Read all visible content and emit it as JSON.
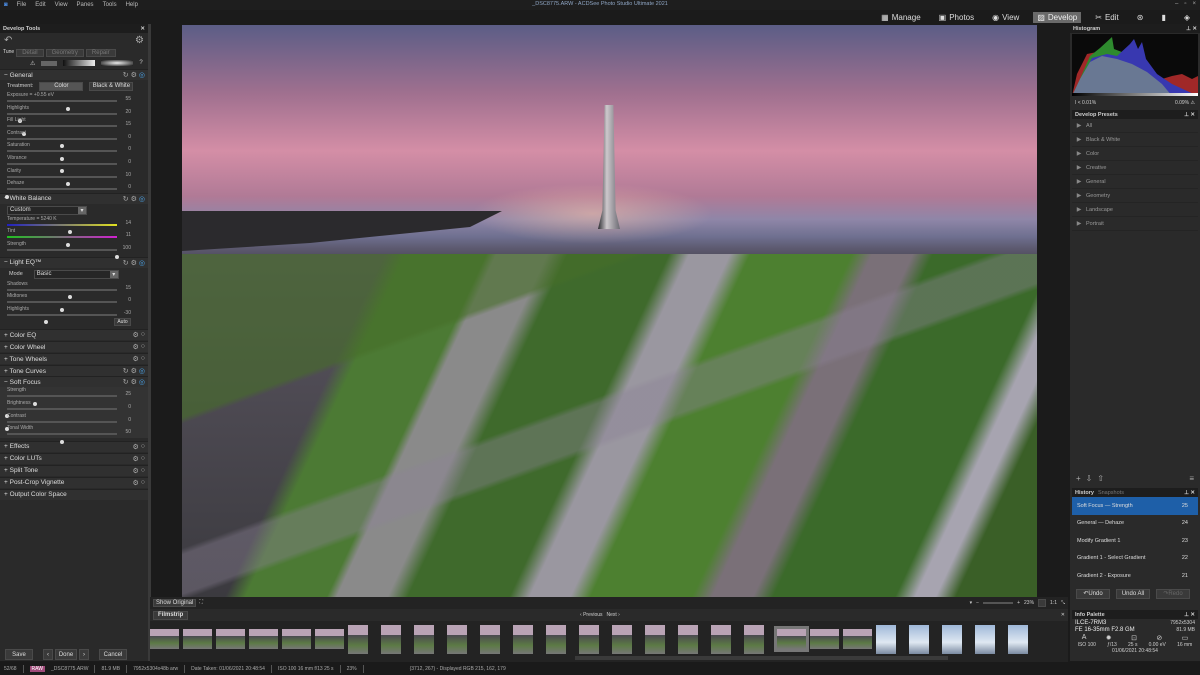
{
  "app": {
    "title": "_DSC8775.ARW - ACDSee Photo Studio Ultimate 2021",
    "menu": [
      "File",
      "Edit",
      "View",
      "Panes",
      "Tools",
      "Help"
    ],
    "modes": [
      {
        "label": "Manage",
        "icon": "grid-icon"
      },
      {
        "label": "Photos",
        "icon": "photos-icon"
      },
      {
        "label": "View",
        "icon": "eye-icon"
      },
      {
        "label": "Develop",
        "icon": "develop-icon",
        "active": true
      },
      {
        "label": "Edit",
        "icon": "edit-icon"
      }
    ]
  },
  "left": {
    "title": "Develop Tools",
    "tabs": [
      "Tune",
      "Detail",
      "Geometry",
      "Repair"
    ],
    "general": {
      "title": "General",
      "treatment_label": "Treatment:",
      "color": "Color",
      "bw": "Black & White",
      "sliders": [
        {
          "label": "Exposure = +0.55 eV",
          "value": "55",
          "pos": 0.55
        },
        {
          "label": "Highlights",
          "value": "20",
          "pos": 0.12
        },
        {
          "label": "Fill Light",
          "value": "15",
          "pos": 0.15
        },
        {
          "label": "Contrast",
          "value": "0",
          "pos": 0.5
        },
        {
          "label": "Saturation",
          "value": "0",
          "pos": 0.5
        },
        {
          "label": "Vibrance",
          "value": "0",
          "pos": 0.5
        },
        {
          "label": "Clarity",
          "value": "10",
          "pos": 0.55
        },
        {
          "label": "Dehaze",
          "value": "0",
          "pos": 0.0
        }
      ]
    },
    "wb": {
      "title": "White Balance",
      "preset": "Custom",
      "sliders": [
        {
          "label": "Temperature = 5240 K",
          "value": "14",
          "pos": 0.57
        },
        {
          "label": "Tint",
          "value": "11",
          "pos": 0.55
        },
        {
          "label": "Strength",
          "value": "100",
          "pos": 1.0
        }
      ]
    },
    "lighteq": {
      "title": "Light EQ™",
      "mode_label": "Mode",
      "mode": "Basic",
      "auto": "Auto",
      "sliders": [
        {
          "label": "Shadows",
          "value": "15",
          "pos": 0.57
        },
        {
          "label": "Midtones",
          "value": "0",
          "pos": 0.5
        },
        {
          "label": "Highlights",
          "value": "-30",
          "pos": 0.35
        }
      ]
    },
    "collapsed1": [
      "Color EQ",
      "Color Wheel",
      "Tone Wheels",
      "Tone Curves"
    ],
    "softfocus": {
      "title": "Soft Focus",
      "sliders": [
        {
          "label": "Strength",
          "value": "25",
          "pos": 0.25
        },
        {
          "label": "Brightness",
          "value": "0",
          "pos": 0.0
        },
        {
          "label": "Contrast",
          "value": "0",
          "pos": 0.0
        },
        {
          "label": "Tonal Width",
          "value": "50",
          "pos": 0.5
        }
      ]
    },
    "collapsed2": [
      "Effects",
      "Color LUTs",
      "Split Tone",
      "Post-Crop Vignette",
      "Output Color Space"
    ],
    "save": "Save",
    "done": "Done",
    "cancel": "Cancel"
  },
  "right": {
    "histogram": {
      "title": "Histogram",
      "low": "< 0.01%",
      "high": "0.09%"
    },
    "presets": {
      "title": "Develop Presets",
      "items": [
        "All",
        "Black & White",
        "Color",
        "Creative",
        "General",
        "Geometry",
        "Landscape",
        "Portrait"
      ]
    },
    "history": {
      "tabs": [
        "History",
        "Snapshots"
      ],
      "items": [
        {
          "label": "Soft Focus — Strength",
          "n": "25"
        },
        {
          "label": "General — Dehaze",
          "n": "24"
        },
        {
          "label": "Modify Gradient 1",
          "n": "23"
        },
        {
          "label": "Gradient 1 - Select Gradient",
          "n": "22"
        },
        {
          "label": "Gradient 2 - Exposure",
          "n": "21"
        }
      ],
      "undo": "Undo",
      "undo_all": "Undo All",
      "redo": "Redo"
    },
    "info": {
      "title": "Info Palette",
      "camera": "ILCE-7RM3",
      "lens": "FE 16-35mm F2.8 GM",
      "dims": "7952x5304",
      "size": "81.9 MB",
      "iso": "ISO 100",
      "aperture": "ƒ/13",
      "shutter": "25 s",
      "ev": "0.00 eV",
      "focal": "16 mm",
      "date": "01/06/2021 20:48:54"
    }
  },
  "viewer": {
    "show_original": "Show Original",
    "zoom": "23%",
    "ratio": "1:1",
    "filmstrip": "Filmstrip",
    "previous": "Previous",
    "next": "Next",
    "thumb_count": 27,
    "selected_thumb": 19
  },
  "status": {
    "index": "52/68",
    "badge": "RAW",
    "file": "_DSC8775.ARW",
    "size": "81.9 MB",
    "dims": "7952x5304x48b arw",
    "date": "Date Taken: 01/06/2021 20:48:54",
    "exif": "ISO 100   16 mm   f/13   25 s",
    "zoom": "23%",
    "pixel": "(3712, 267) - Displayed RGB 215, 162, 179"
  }
}
